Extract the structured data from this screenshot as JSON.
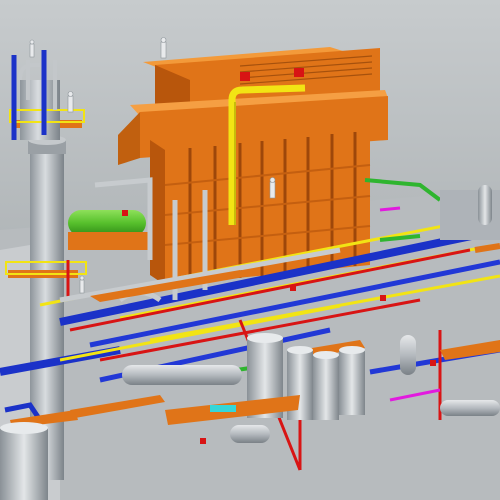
{
  "scene": {
    "subject": "plant-3d-model",
    "colors": {
      "background_top": "#bfc3c6",
      "background_bottom": "#9ea3a6",
      "deck": "#dfe1e2",
      "orange_structure": "#e07418",
      "orange_dark": "#b8560c",
      "orange_light": "#f39a3a",
      "steel_grey": "#aeb3b8",
      "steel_dark": "#6f767c",
      "pipe_blue": "#1b32c8",
      "pipe_yellow": "#f2e414",
      "pipe_red": "#d81414",
      "pipe_green": "#2fb52f",
      "pipe_magenta": "#e21adf",
      "vessel_green": "#57c02c",
      "cyan_panel": "#35d6d8"
    }
  }
}
